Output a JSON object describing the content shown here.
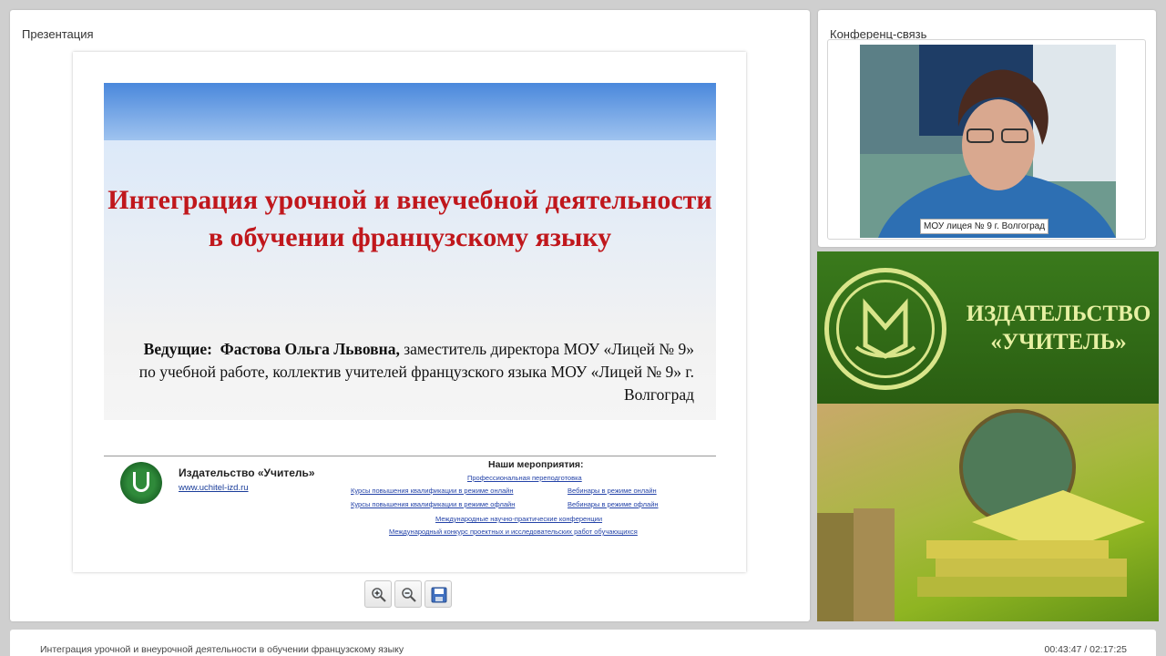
{
  "presentation": {
    "panel_title": "Презентация",
    "slide": {
      "title": "Интеграция урочной и внеучебной деятельности в обучении французскому языку",
      "presenter_label": "Ведущие:",
      "presenter_name": "Фастова Ольга Львовна,",
      "presenter_details": "заместитель директора МОУ «Лицей № 9» по учебной работе, коллектив учителей французского языка МОУ «Лицей № 9» г. Волгоград",
      "company_name": "Издательство «Учитель»",
      "company_site": "www.uchitel-izd.ru",
      "events_heading": "Наши мероприятия:",
      "links": [
        "Профессиональная переподготовка",
        "Курсы повышения квалификации в режиме онлайн",
        "Вебинары в режиме онлайн",
        "Курсы повышения квалификации в режиме офлайн",
        "Вебинары в режиме офлайн",
        "Международные научно-практические конференции",
        "Международный конкурс проектных и исследовательских работ обучающихся"
      ]
    },
    "toolbar": {
      "zoom_in_icon": "zoom-in-icon",
      "zoom_out_icon": "zoom-out-icon",
      "save_icon": "save-icon"
    }
  },
  "conference": {
    "panel_title": "Конференц-связь",
    "video_caption": "МОУ лицея № 9 г. Волгоград"
  },
  "ad": {
    "line1": "ИЗДАТЕЛЬСТВО",
    "line2": "«УЧИТЕЛЬ»"
  },
  "status": {
    "title": "Интеграция урочной и внеурочной деятельности в обучении французскому языку",
    "time": "00:43:47 / 02:17:25"
  },
  "colors": {
    "slide_title": "#c0171c",
    "ad_green": "#2f6a17",
    "ad_text": "#e7f0a3"
  }
}
